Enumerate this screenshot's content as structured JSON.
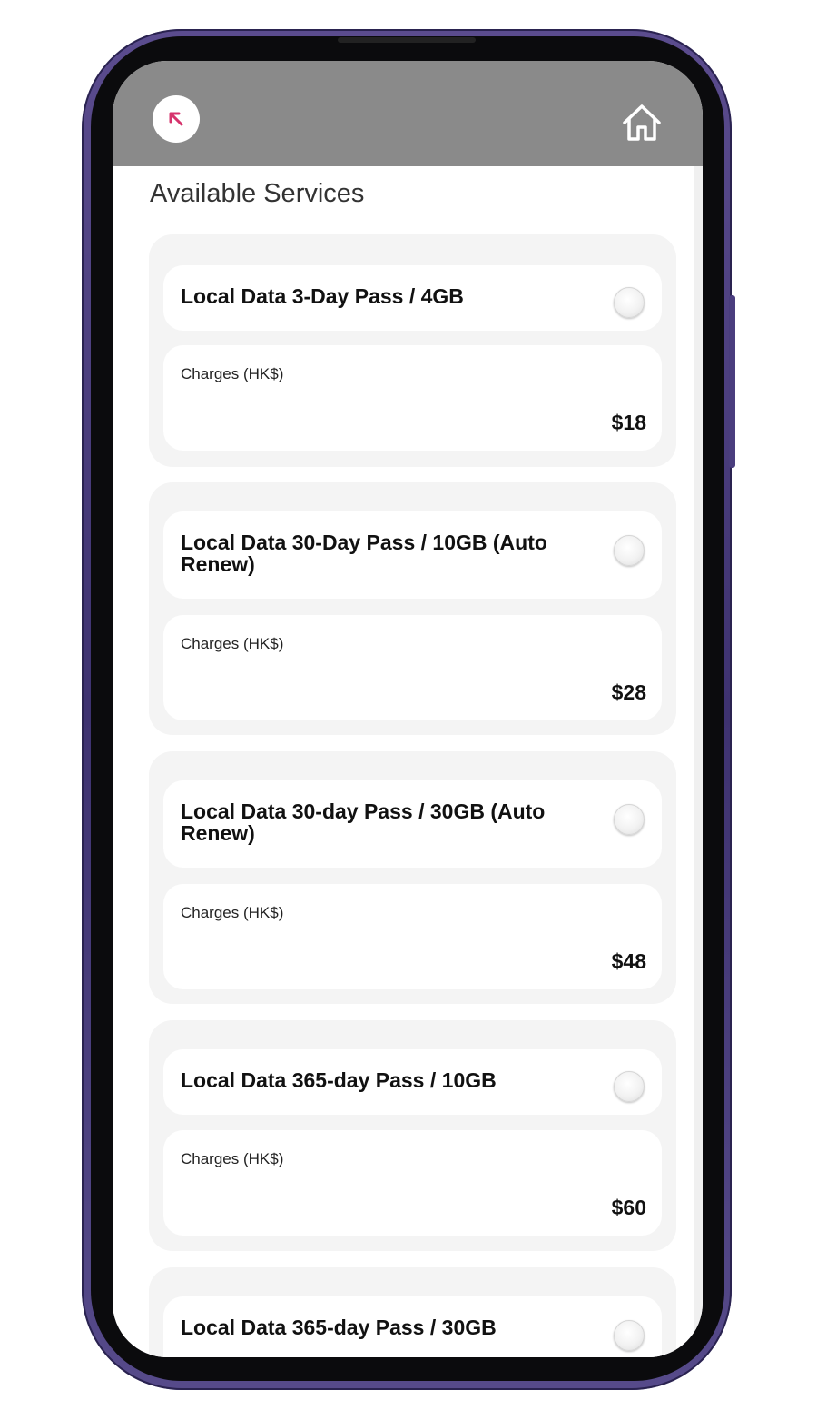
{
  "page": {
    "title": "Available Services",
    "charges_label": "Charges (HK$)"
  },
  "header": {
    "background": "#8a8a8a",
    "back_icon": "arrow-up-left-icon",
    "home_icon": "home-icon",
    "accent_color": "#d6336c"
  },
  "services": [
    {
      "name": "Local Data 3-Day Pass / 4GB",
      "price": "$18",
      "selected": false
    },
    {
      "name": "Local Data 30-Day Pass / 10GB (Auto Renew)",
      "price": "$28",
      "selected": false
    },
    {
      "name": "Local Data 30-day Pass / 30GB (Auto Renew)",
      "price": "$48",
      "selected": false
    },
    {
      "name": "Local Data 365-day Pass / 10GB",
      "price": "$60",
      "selected": false
    },
    {
      "name": "Local Data 365-day Pass / 30GB",
      "selected": false
    }
  ]
}
